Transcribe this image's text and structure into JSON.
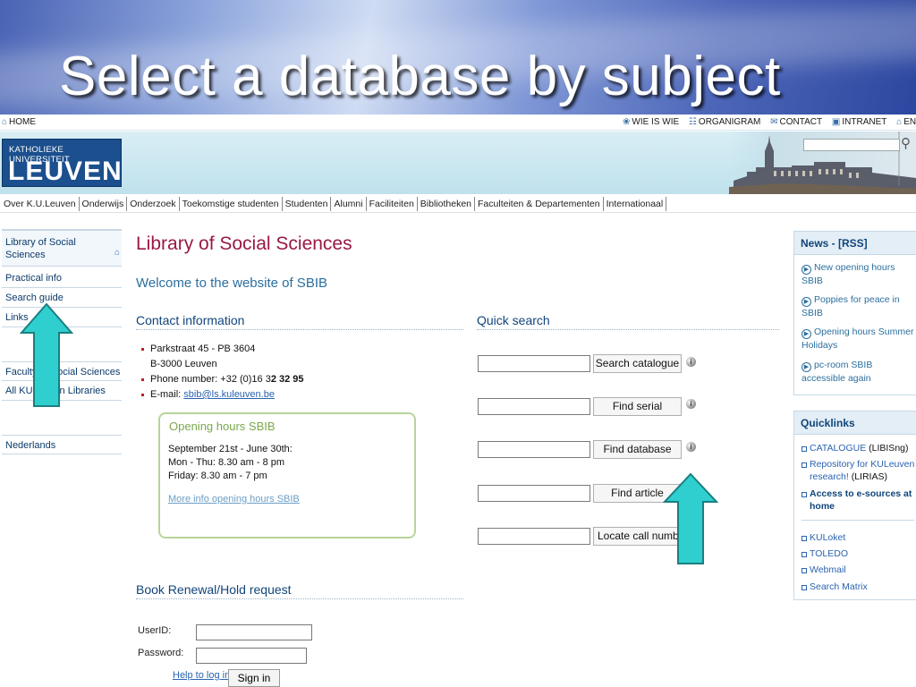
{
  "slide": {
    "title": "Select a database by subject"
  },
  "topbar": {
    "home": "HOME",
    "links": [
      "WIE IS WIE",
      "ORGANIGRAM",
      "CONTACT",
      "INTRANET",
      "ENGLIS"
    ]
  },
  "logo": {
    "line1": "KATHOLIEKE UNIVERSITEIT",
    "line2": "LEUVEN"
  },
  "nav": {
    "items": [
      "Over K.U.Leuven",
      "Onderwijs",
      "Onderzoek",
      "Toekomstige studenten",
      "Studenten",
      "Alumni",
      "Faciliteiten",
      "Bibliotheken",
      "Faculteiten & Departementen",
      "Internationaal"
    ]
  },
  "sidebar": {
    "items": [
      "Library of Social Sciences",
      "Practical info",
      "Search guide",
      "Links",
      "Faculty of Social Sciences",
      "All KULeuven Libraries",
      "Nederlands"
    ]
  },
  "main": {
    "title": "Library of Social Sciences",
    "welcome": "Welcome to the website of SBIB",
    "contact_title": "Contact information",
    "contact": {
      "address1": "Parkstraat 45 - PB 3604",
      "address2": "B-3000 Leuven",
      "phone_label": "Phone number: +32 (0)16 3",
      "phone_bold": "2 32 95",
      "email_label": "E-mail: ",
      "email": "sbib@ls.kuleuven.be"
    },
    "hours": {
      "title": "Opening hours SBIB",
      "line1": "September 21st - June 30th:",
      "line2": "Mon - Thu: 8.30 am - 8 pm",
      "line3": "Friday: 8.30 am - 7 pm",
      "link": "More info opening hours SBIB"
    },
    "renewal": {
      "title": "Book Renewal/Hold request",
      "userid_label": "UserID:",
      "password_label": "Password:",
      "help": "Help to log in",
      "signin": "Sign in"
    }
  },
  "quick_search": {
    "title": "Quick search",
    "buttons": [
      "Search catalogue",
      "Find serial",
      "Find database",
      "Find article",
      "Locate call number"
    ],
    "info_glyph": "i"
  },
  "news": {
    "title": "News - [RSS]",
    "items": [
      "New opening hours SBIB",
      "Poppies for peace in SBIB",
      "Opening hours Summer Holidays",
      "pc-room SBIB accessible again"
    ]
  },
  "quicklinks": {
    "title": "Quicklinks",
    "catalogue": "CATALOGUE",
    "catalogue_suffix": " (LIBISng)",
    "repository": "Repository for KULeuven research!",
    "repository_suffix": " (LIRIAS)",
    "eaccess": "Access to e-sources at home",
    "others": [
      "KULoket",
      "TOLEDO",
      "Webmail",
      "Search Matrix"
    ]
  },
  "colors": {
    "arrow_fill": "#2fcfcf",
    "arrow_stroke": "#1a7f80",
    "title_red": "#9a1843",
    "heading_blue": "#10457a"
  }
}
